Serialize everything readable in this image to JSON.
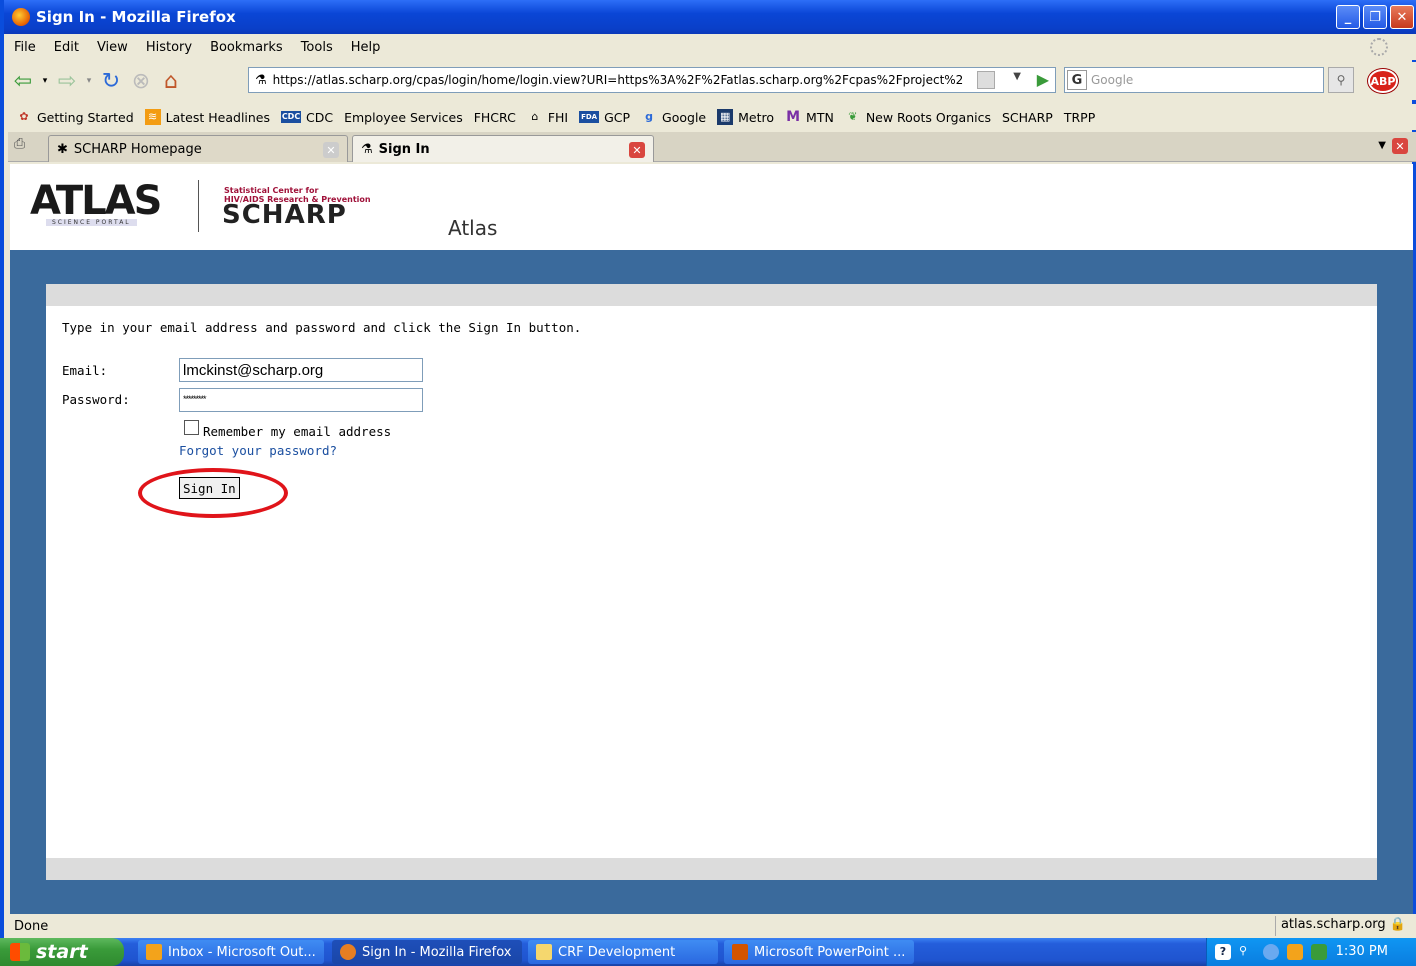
{
  "window": {
    "title": "Sign In - Mozilla Firefox",
    "buttons": [
      "_",
      "❐",
      "✕"
    ]
  },
  "menu": [
    "File",
    "Edit",
    "View",
    "History",
    "Bookmarks",
    "Tools",
    "Help"
  ],
  "nav": {
    "url": "https://atlas.scharp.org/cpas/login/home/login.view?URI=https%3A%2F%2Fatlas.scharp.org%2Fcpas%2Fproject%2",
    "search_placeholder": "Google",
    "abp": "ABP"
  },
  "bookmarks": [
    "Getting Started",
    "Latest Headlines",
    "CDC",
    "Employee Services",
    "FHCRC",
    "FHI",
    "GCP",
    "Google",
    "Metro",
    "MTN",
    "New Roots Organics",
    "SCHARP",
    "TRPP"
  ],
  "bookmark_icons": {
    "cdc": "CDC",
    "fda": "FDA"
  },
  "tabs": [
    {
      "label": "SCHARP Homepage",
      "active": false
    },
    {
      "label": "Sign In",
      "active": true
    }
  ],
  "header": {
    "logo_atlas": "ATLAS",
    "logo_atlas_sub": "SCIENCE PORTAL",
    "scharp_small_1": "Statistical Center for",
    "scharp_small_2": "HIV/AIDS Research & Prevention",
    "scharp_big": "SCHARP",
    "app_name": "Atlas"
  },
  "login": {
    "instructions": "Type in your email address and password and click the Sign In button.",
    "email_label": "Email:",
    "email_value": "lmckinst@scharp.org",
    "password_label": "Password:",
    "password_value": "*********",
    "remember_label": "Remember my email address",
    "remember_checked": false,
    "forgot_link": "Forgot your password?",
    "signin_button": "Sign In",
    "highlight_color": "#e0141a"
  },
  "status": {
    "left": "Done",
    "right": "atlas.scharp.org"
  },
  "taskbar": {
    "start": "start",
    "tasks": [
      "Inbox - Microsoft Out...",
      "Sign In - Mozilla Firefox",
      "CRF Development",
      "Microsoft PowerPoint ..."
    ],
    "time": "1:30 PM"
  }
}
